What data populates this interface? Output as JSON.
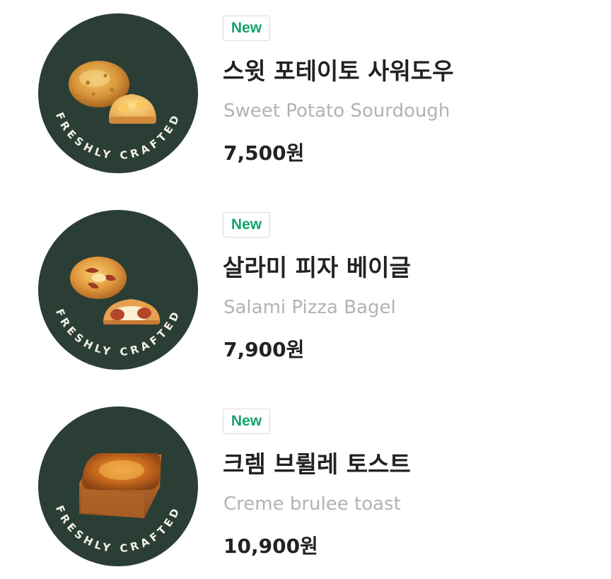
{
  "products": [
    {
      "badge": "New",
      "name_ko": "스윗 포테이토 사워도우",
      "name_en": "Sweet Potato Sourdough",
      "price": "7,500원",
      "stamp": "FRESHLY CRAFTED",
      "image_icon": "sourdough-bread-icon"
    },
    {
      "badge": "New",
      "name_ko": "살라미 피자 베이글",
      "name_en": "Salami Pizza Bagel",
      "price": "7,900원",
      "stamp": "FRESHLY CRAFTED",
      "image_icon": "pizza-bagel-icon"
    },
    {
      "badge": "New",
      "name_ko": "크렘 브륄레 토스트",
      "name_en": "Creme brulee toast",
      "price": "10,900원",
      "stamp": "FRESHLY CRAFTED",
      "image_icon": "brulee-toast-icon"
    }
  ],
  "colors": {
    "thumbnail_bg": "#2b3e36",
    "badge_text": "#14a36a",
    "title_text": "#222222",
    "subtitle_text": "#b3b3b3"
  }
}
